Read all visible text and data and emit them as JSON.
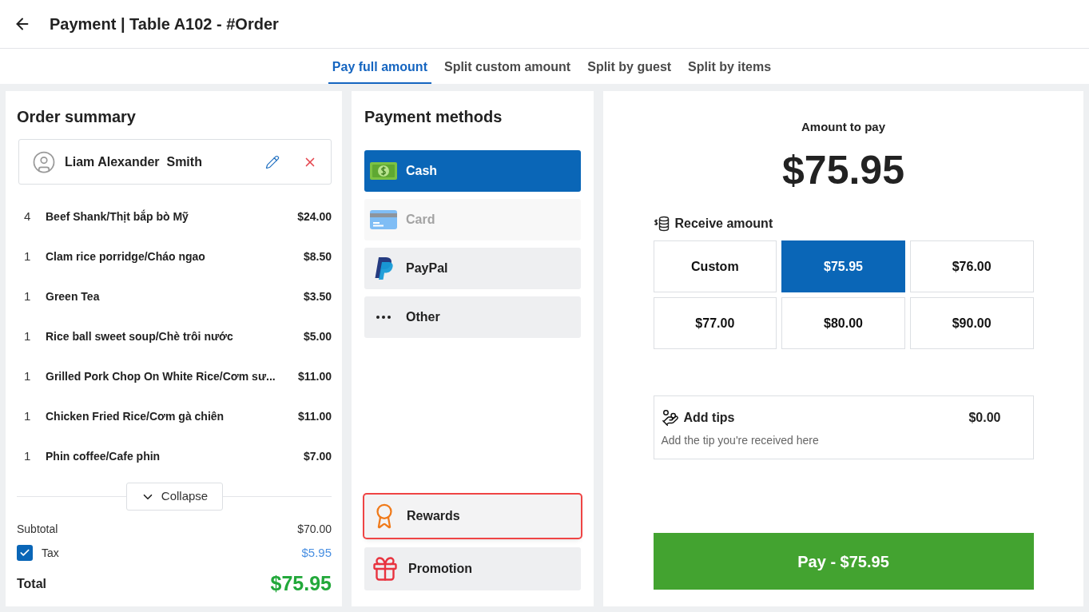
{
  "header": {
    "title": "Payment | Table A102 - #Order"
  },
  "tabs": [
    {
      "label": "Pay full amount",
      "selected": true
    },
    {
      "label": "Split custom amount",
      "selected": false
    },
    {
      "label": "Split by guest",
      "selected": false
    },
    {
      "label": "Split by items",
      "selected": false
    }
  ],
  "order_summary": {
    "title": "Order summary",
    "customer": {
      "name": "Liam Alexander  Smith"
    },
    "items": [
      {
        "qty": "4",
        "name": "Beef Shank/Thịt bắp bò Mỹ",
        "price": "$24.00"
      },
      {
        "qty": "1",
        "name": "Clam rice porridge/Cháo ngao",
        "price": "$8.50"
      },
      {
        "qty": "1",
        "name": "Green Tea",
        "price": "$3.50"
      },
      {
        "qty": "1",
        "name": "Rice ball sweet soup/Chè trôi nước",
        "price": "$5.00"
      },
      {
        "qty": "1",
        "name": "Grilled Pork Chop On White Rice/Cơm sư...",
        "price": "$11.00"
      },
      {
        "qty": "1",
        "name": "Chicken Fried Rice/Cơm gà chiên",
        "price": "$11.00"
      },
      {
        "qty": "1",
        "name": "Phin coffee/Cafe phin",
        "price": "$7.00"
      }
    ],
    "collapse_button": "Collapse",
    "subtotal": {
      "label": "Subtotal",
      "value": "$70.00"
    },
    "tax": {
      "label": "Tax",
      "checked": true,
      "value": "$5.95"
    },
    "total": {
      "label": "Total",
      "value": "$75.95"
    }
  },
  "payment_methods": {
    "title": "Payment methods",
    "methods": [
      {
        "label": "Cash",
        "kind": "cash",
        "selected": true,
        "disabled": false
      },
      {
        "label": "Card",
        "kind": "card",
        "selected": false,
        "disabled": true
      },
      {
        "label": "PayPal",
        "kind": "paypal",
        "selected": false,
        "disabled": false
      },
      {
        "label": "Other",
        "kind": "other",
        "selected": false,
        "disabled": false
      }
    ],
    "extras": [
      {
        "label": "Rewards",
        "kind": "rewards",
        "highlighted": true
      },
      {
        "label": "Promotion",
        "kind": "promotion",
        "highlighted": false
      }
    ]
  },
  "payment": {
    "amount_label": "Amount to pay",
    "amount": "$75.95",
    "receive_label": "Receive amount",
    "options": [
      {
        "label": "Custom",
        "selected": false
      },
      {
        "label": "$75.95",
        "selected": true
      },
      {
        "label": "$76.00",
        "selected": false
      },
      {
        "label": "$77.00",
        "selected": false
      },
      {
        "label": "$80.00",
        "selected": false
      },
      {
        "label": "$90.00",
        "selected": false
      }
    ],
    "tips": {
      "title": "Add tips",
      "value": "$0.00",
      "hint": "Add the tip you're received here"
    },
    "pay_button": "Pay - $75.95"
  }
}
